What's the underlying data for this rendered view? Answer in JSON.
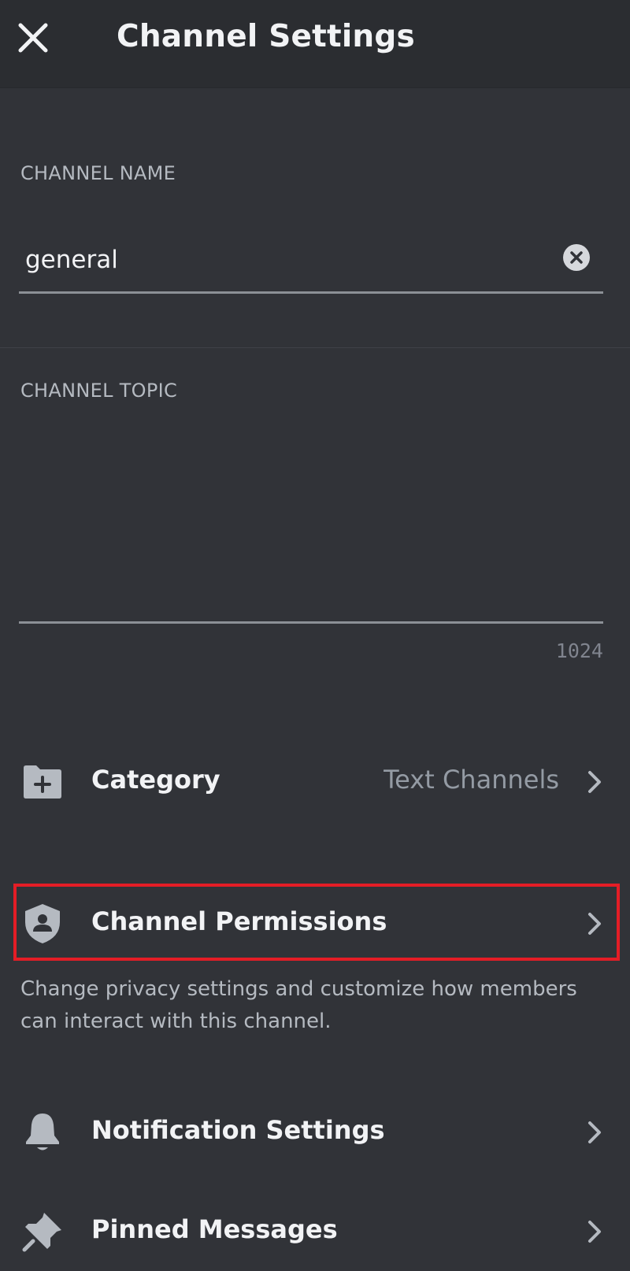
{
  "header": {
    "title": "Channel Settings",
    "close_icon": "close-icon"
  },
  "channel_name": {
    "label": "CHANNEL NAME",
    "value": "general",
    "clear_icon": "clear-circle-x-icon"
  },
  "channel_topic": {
    "label": "CHANNEL TOPIC",
    "value": "",
    "char_remaining": "1024"
  },
  "rows": {
    "category": {
      "label": "Category",
      "value": "Text Channels",
      "icon": "folder-plus-icon"
    },
    "permissions": {
      "label": "Channel Permissions",
      "icon": "shield-user-icon",
      "description": "Change privacy settings and customize how members can interact with this channel.",
      "highlighted": true
    },
    "notifications": {
      "label": "Notification Settings",
      "icon": "bell-icon"
    },
    "pinned": {
      "label": "Pinned Messages",
      "icon": "pin-icon"
    }
  },
  "colors": {
    "background": "#313338",
    "header": "#2b2d31",
    "highlight": "#e41d26",
    "muted_text": "#b5bac1",
    "icon": "#b5bac1"
  }
}
